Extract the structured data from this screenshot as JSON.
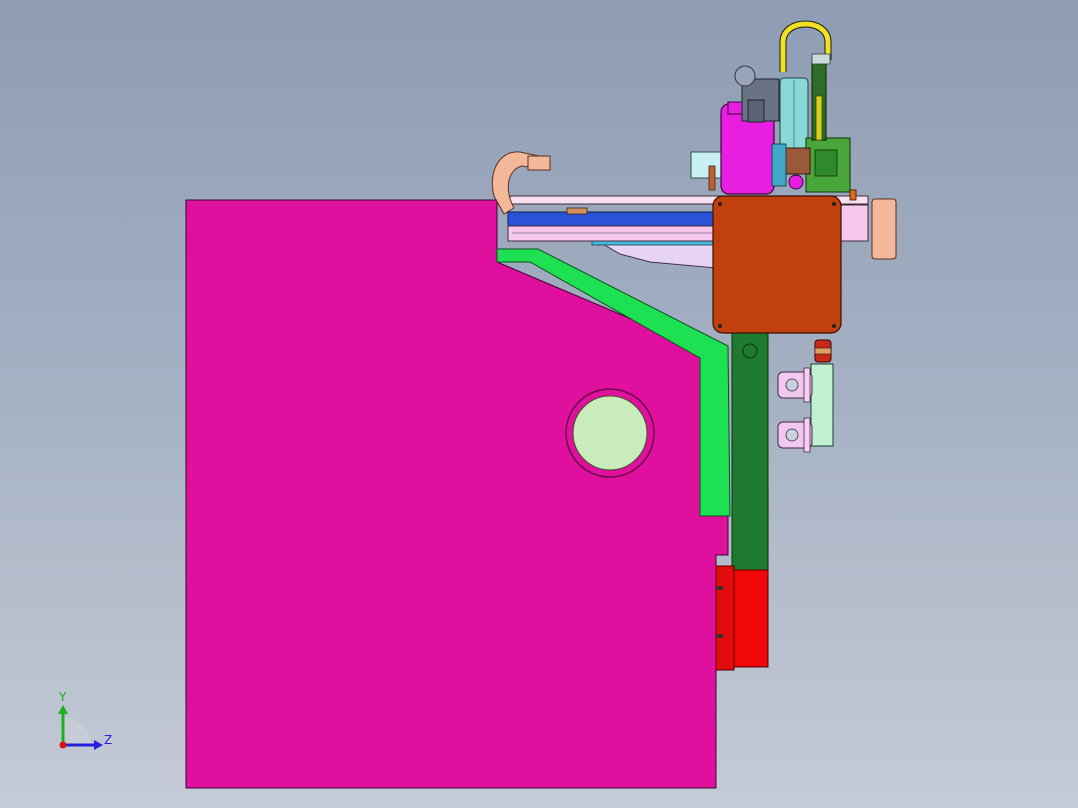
{
  "viewport": {
    "background_top": "#8e9cb4",
    "background_bottom": "#c5cbd6"
  },
  "model": {
    "colors": {
      "frame": "#e0109e",
      "green_rail": "#1de052",
      "dark_green_column": "#1e7a2e",
      "red_block": "#f00808",
      "orange_box": "#c0410e",
      "magenta_motor": "#e81ee0",
      "peach": "#f3b79a",
      "light_pink": "#f6c8ee",
      "blue_rail": "#2a52d6",
      "cyan": "#45b9e0",
      "port_fill": "#c8ecbc",
      "mint": "#bff0d2"
    }
  },
  "triad": {
    "y_label": "Y",
    "z_label": "Z",
    "y_color": "#19b219",
    "z_color": "#2222dd",
    "x_color": "#dd1111"
  }
}
